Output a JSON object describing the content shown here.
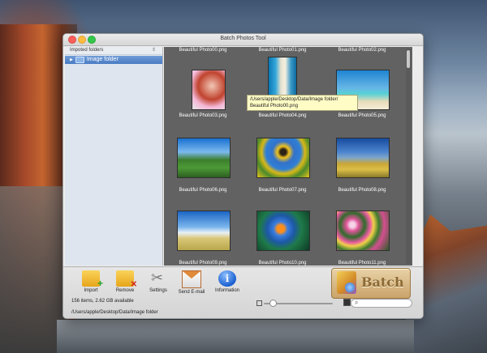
{
  "window": {
    "title": "Batch Photos Tool"
  },
  "sidebar": {
    "header": "Impoted folders",
    "collapse_glyph": "⇕",
    "items": [
      {
        "label": "Image folder"
      }
    ]
  },
  "thumbnails": [
    {
      "label": "Beautiful Photo00.png"
    },
    {
      "label": "Beautiful Photo01.png"
    },
    {
      "label": "Beautiful Photo02.png"
    },
    {
      "label": "Beautiful Photo03.png"
    },
    {
      "label": "Beautiful Photo04.png"
    },
    {
      "label": "Beautiful Photo05.png"
    },
    {
      "label": "Beautiful Photo06.png"
    },
    {
      "label": "Beautiful Photo07.png"
    },
    {
      "label": "Beautiful Photo08.png"
    },
    {
      "label": "Beautiful Photo09.png"
    },
    {
      "label": "Beautiful Photo10.png"
    },
    {
      "label": "Beautiful Photo11.png"
    }
  ],
  "tooltip": {
    "line1": "/Users/apple/Desktop/Data/Image folder/",
    "line2": "Beautiful Photo00.png"
  },
  "toolbar": {
    "import": "Import",
    "remove": "Remove",
    "settings": "Settings",
    "send_email": "Send E-mail",
    "information": "Information",
    "information_glyph": "i",
    "batch": "Batch"
  },
  "status": {
    "items": "156 items, 2.62 GB available",
    "path": "/Users/apple/Desktop/Data/Image folder"
  },
  "search": {
    "placeholder": ""
  },
  "icons": [
    "folder-import-icon",
    "folder-remove-icon",
    "settings-tools-icon",
    "email-envelope-icon",
    "information-icon",
    "batch-app-icon",
    "search-icon"
  ]
}
